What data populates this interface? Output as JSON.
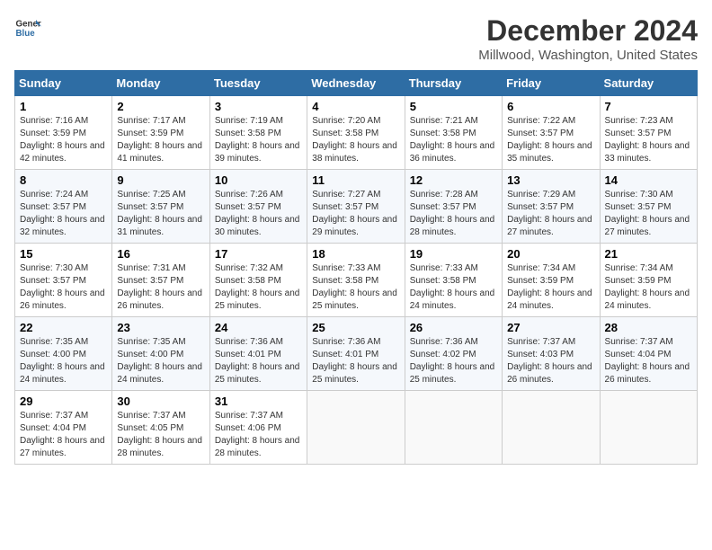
{
  "logo": {
    "line1": "General",
    "line2": "Blue"
  },
  "title": "December 2024",
  "subtitle": "Millwood, Washington, United States",
  "days_header": [
    "Sunday",
    "Monday",
    "Tuesday",
    "Wednesday",
    "Thursday",
    "Friday",
    "Saturday"
  ],
  "weeks": [
    [
      {
        "day": "1",
        "sunrise": "7:16 AM",
        "sunset": "3:59 PM",
        "daylight": "8 hours and 42 minutes."
      },
      {
        "day": "2",
        "sunrise": "7:17 AM",
        "sunset": "3:59 PM",
        "daylight": "8 hours and 41 minutes."
      },
      {
        "day": "3",
        "sunrise": "7:19 AM",
        "sunset": "3:58 PM",
        "daylight": "8 hours and 39 minutes."
      },
      {
        "day": "4",
        "sunrise": "7:20 AM",
        "sunset": "3:58 PM",
        "daylight": "8 hours and 38 minutes."
      },
      {
        "day": "5",
        "sunrise": "7:21 AM",
        "sunset": "3:58 PM",
        "daylight": "8 hours and 36 minutes."
      },
      {
        "day": "6",
        "sunrise": "7:22 AM",
        "sunset": "3:57 PM",
        "daylight": "8 hours and 35 minutes."
      },
      {
        "day": "7",
        "sunrise": "7:23 AM",
        "sunset": "3:57 PM",
        "daylight": "8 hours and 33 minutes."
      }
    ],
    [
      {
        "day": "8",
        "sunrise": "7:24 AM",
        "sunset": "3:57 PM",
        "daylight": "8 hours and 32 minutes."
      },
      {
        "day": "9",
        "sunrise": "7:25 AM",
        "sunset": "3:57 PM",
        "daylight": "8 hours and 31 minutes."
      },
      {
        "day": "10",
        "sunrise": "7:26 AM",
        "sunset": "3:57 PM",
        "daylight": "8 hours and 30 minutes."
      },
      {
        "day": "11",
        "sunrise": "7:27 AM",
        "sunset": "3:57 PM",
        "daylight": "8 hours and 29 minutes."
      },
      {
        "day": "12",
        "sunrise": "7:28 AM",
        "sunset": "3:57 PM",
        "daylight": "8 hours and 28 minutes."
      },
      {
        "day": "13",
        "sunrise": "7:29 AM",
        "sunset": "3:57 PM",
        "daylight": "8 hours and 27 minutes."
      },
      {
        "day": "14",
        "sunrise": "7:30 AM",
        "sunset": "3:57 PM",
        "daylight": "8 hours and 27 minutes."
      }
    ],
    [
      {
        "day": "15",
        "sunrise": "7:30 AM",
        "sunset": "3:57 PM",
        "daylight": "8 hours and 26 minutes."
      },
      {
        "day": "16",
        "sunrise": "7:31 AM",
        "sunset": "3:57 PM",
        "daylight": "8 hours and 26 minutes."
      },
      {
        "day": "17",
        "sunrise": "7:32 AM",
        "sunset": "3:58 PM",
        "daylight": "8 hours and 25 minutes."
      },
      {
        "day": "18",
        "sunrise": "7:33 AM",
        "sunset": "3:58 PM",
        "daylight": "8 hours and 25 minutes."
      },
      {
        "day": "19",
        "sunrise": "7:33 AM",
        "sunset": "3:58 PM",
        "daylight": "8 hours and 24 minutes."
      },
      {
        "day": "20",
        "sunrise": "7:34 AM",
        "sunset": "3:59 PM",
        "daylight": "8 hours and 24 minutes."
      },
      {
        "day": "21",
        "sunrise": "7:34 AM",
        "sunset": "3:59 PM",
        "daylight": "8 hours and 24 minutes."
      }
    ],
    [
      {
        "day": "22",
        "sunrise": "7:35 AM",
        "sunset": "4:00 PM",
        "daylight": "8 hours and 24 minutes."
      },
      {
        "day": "23",
        "sunrise": "7:35 AM",
        "sunset": "4:00 PM",
        "daylight": "8 hours and 24 minutes."
      },
      {
        "day": "24",
        "sunrise": "7:36 AM",
        "sunset": "4:01 PM",
        "daylight": "8 hours and 25 minutes."
      },
      {
        "day": "25",
        "sunrise": "7:36 AM",
        "sunset": "4:01 PM",
        "daylight": "8 hours and 25 minutes."
      },
      {
        "day": "26",
        "sunrise": "7:36 AM",
        "sunset": "4:02 PM",
        "daylight": "8 hours and 25 minutes."
      },
      {
        "day": "27",
        "sunrise": "7:37 AM",
        "sunset": "4:03 PM",
        "daylight": "8 hours and 26 minutes."
      },
      {
        "day": "28",
        "sunrise": "7:37 AM",
        "sunset": "4:04 PM",
        "daylight": "8 hours and 26 minutes."
      }
    ],
    [
      {
        "day": "29",
        "sunrise": "7:37 AM",
        "sunset": "4:04 PM",
        "daylight": "8 hours and 27 minutes."
      },
      {
        "day": "30",
        "sunrise": "7:37 AM",
        "sunset": "4:05 PM",
        "daylight": "8 hours and 28 minutes."
      },
      {
        "day": "31",
        "sunrise": "7:37 AM",
        "sunset": "4:06 PM",
        "daylight": "8 hours and 28 minutes."
      },
      null,
      null,
      null,
      null
    ]
  ]
}
